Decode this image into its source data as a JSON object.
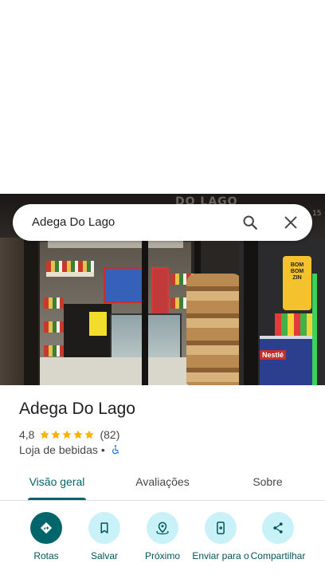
{
  "hero": {
    "roof_sign": "DO LAGO",
    "side_sign": "15",
    "promo": "BOM BOM ZIN",
    "freezer_brand": "Nestlé"
  },
  "search": {
    "query": "Adega Do Lago",
    "search_icon": "search-icon",
    "close_icon": "close-icon"
  },
  "place": {
    "name": "Adega Do Lago",
    "rating": "4,8",
    "stars": 5,
    "review_count": "(82)",
    "category": "Loja de bebidas",
    "separator": "•",
    "accessibility_icon": "wheelchair-icon",
    "star_color": "#f6b400"
  },
  "tabs": [
    {
      "label": "Visão geral",
      "active": true
    },
    {
      "label": "Avaliações",
      "active": false
    },
    {
      "label": "Sobre",
      "active": false
    }
  ],
  "actions": [
    {
      "label": "Rotas",
      "icon": "directions-icon",
      "primary": true
    },
    {
      "label": "Salvar",
      "icon": "bookmark-icon",
      "primary": false
    },
    {
      "label": "Próximo",
      "icon": "nearby-icon",
      "primary": false
    },
    {
      "label": "Enviar para o",
      "icon": "send-to-phone-icon",
      "primary": false
    },
    {
      "label": "Compartilhar",
      "icon": "share-icon",
      "primary": false
    }
  ],
  "colors": {
    "accent": "#00666b",
    "action_bg": "#c9f2f8",
    "text_primary": "#1f1f1f",
    "text_secondary": "#474747"
  }
}
